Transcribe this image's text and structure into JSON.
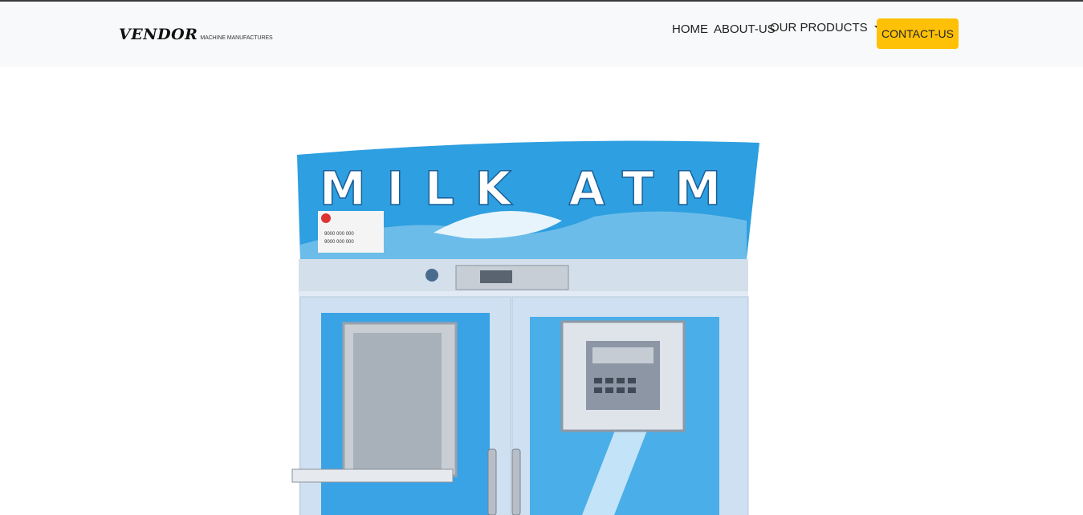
{
  "brand": {
    "name": "VENDOR",
    "tagline": "MACHINE MANUFACTURES"
  },
  "nav": {
    "home": "HOME",
    "about": "ABOUT-US",
    "products": "OUR PRODUCTS",
    "contact": "CONTACT-US"
  },
  "hero": {
    "sign_text": "MILK ATM",
    "label_lines": [
      "9000 000 000",
      "9000 000 000"
    ]
  },
  "colors": {
    "navbar_bg": "#f8f9fa",
    "contact_bg": "#ffc107",
    "machine_blue": "#2e9fe0",
    "machine_panel": "#dde8f5"
  }
}
